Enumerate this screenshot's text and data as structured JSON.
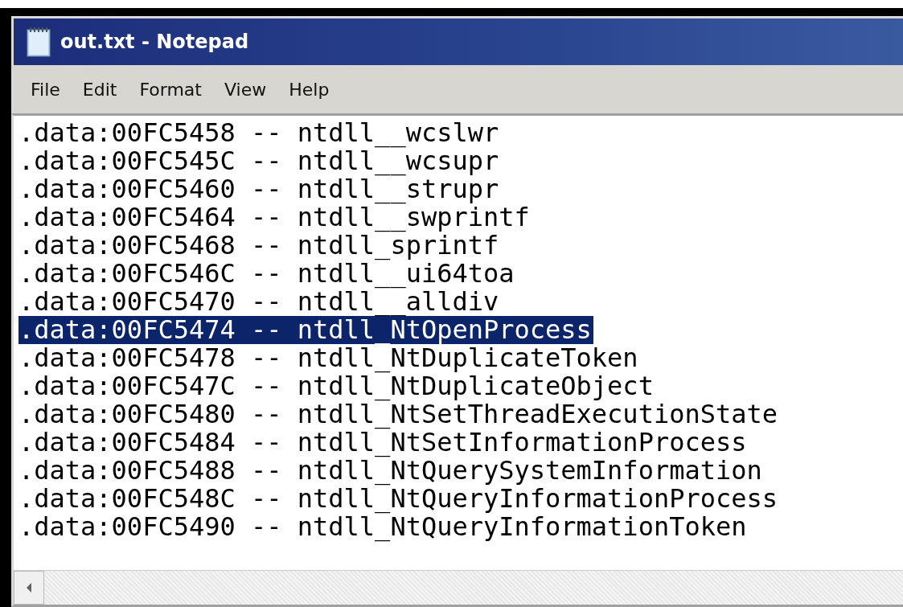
{
  "window": {
    "title": "out.txt - Notepad"
  },
  "menu": [
    "File",
    "Edit",
    "Format",
    "View",
    "Help"
  ],
  "lines": [
    {
      "text": ".data:00FC5458 -- ntdll__wcslwr",
      "selected": false
    },
    {
      "text": ".data:00FC545C -- ntdll__wcsupr",
      "selected": false
    },
    {
      "text": ".data:00FC5460 -- ntdll__strupr",
      "selected": false
    },
    {
      "text": ".data:00FC5464 -- ntdll__swprintf",
      "selected": false
    },
    {
      "text": ".data:00FC5468 -- ntdll_sprintf",
      "selected": false
    },
    {
      "text": ".data:00FC546C -- ntdll__ui64toa",
      "selected": false
    },
    {
      "text": ".data:00FC5470 -- ntdll__alldiv",
      "selected": false
    },
    {
      "text": ".data:00FC5474 -- ntdll_NtOpenProcess",
      "selected": true
    },
    {
      "text": ".data:00FC5478 -- ntdll_NtDuplicateToken",
      "selected": false
    },
    {
      "text": ".data:00FC547C -- ntdll_NtDuplicateObject",
      "selected": false
    },
    {
      "text": ".data:00FC5480 -- ntdll_NtSetThreadExecutionState",
      "selected": false
    },
    {
      "text": ".data:00FC5484 -- ntdll_NtSetInformationProcess",
      "selected": false
    },
    {
      "text": ".data:00FC5488 -- ntdll_NtQuerySystemInformation",
      "selected": false
    },
    {
      "text": ".data:00FC548C -- ntdll_NtQueryInformationProcess",
      "selected": false
    },
    {
      "text": ".data:00FC5490 -- ntdll_NtQueryInformationToken",
      "selected": false
    }
  ]
}
